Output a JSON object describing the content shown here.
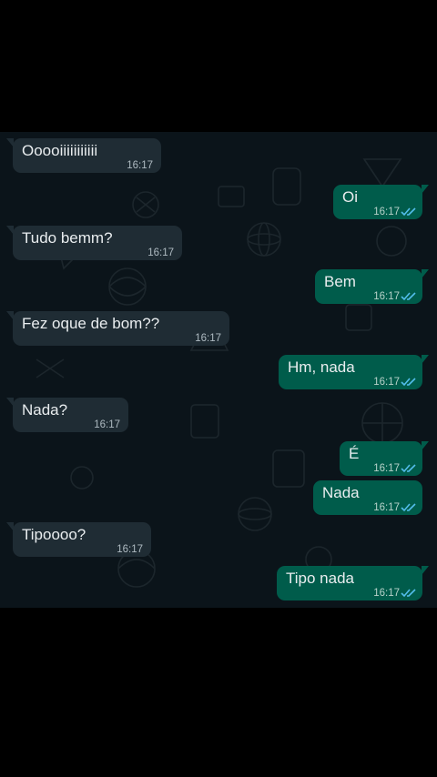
{
  "colors": {
    "background": "#000000",
    "chat_background": "#0b141a",
    "incoming_bubble": "#1f2c34",
    "outgoing_bubble": "#005c4b",
    "read_ticks": "#53bdeb"
  },
  "messages": [
    {
      "direction": "incoming",
      "text": "Ooooiiiiiiiiiii",
      "time": "16:17"
    },
    {
      "direction": "outgoing",
      "text": "Oi",
      "time": "16:17",
      "status_icon": "double-check-read-icon"
    },
    {
      "direction": "incoming",
      "text": "Tudo bemm?",
      "time": "16:17"
    },
    {
      "direction": "outgoing",
      "text": "Bem",
      "time": "16:17",
      "status_icon": "double-check-read-icon"
    },
    {
      "direction": "incoming",
      "text": "Fez oque de bom??",
      "time": "16:17"
    },
    {
      "direction": "outgoing",
      "text": "Hm, nada",
      "time": "16:17",
      "status_icon": "double-check-read-icon"
    },
    {
      "direction": "incoming",
      "text": "Nada?",
      "time": "16:17"
    },
    {
      "direction": "outgoing",
      "text": "É",
      "time": "16:17",
      "status_icon": "double-check-read-icon"
    },
    {
      "direction": "outgoing",
      "text": "Nada",
      "time": "16:17",
      "status_icon": "double-check-read-icon"
    },
    {
      "direction": "incoming",
      "text": "Tipoooo?",
      "time": "16:17"
    },
    {
      "direction": "outgoing",
      "text": "Tipo nada",
      "time": "16:17",
      "status_icon": "double-check-read-icon"
    }
  ]
}
